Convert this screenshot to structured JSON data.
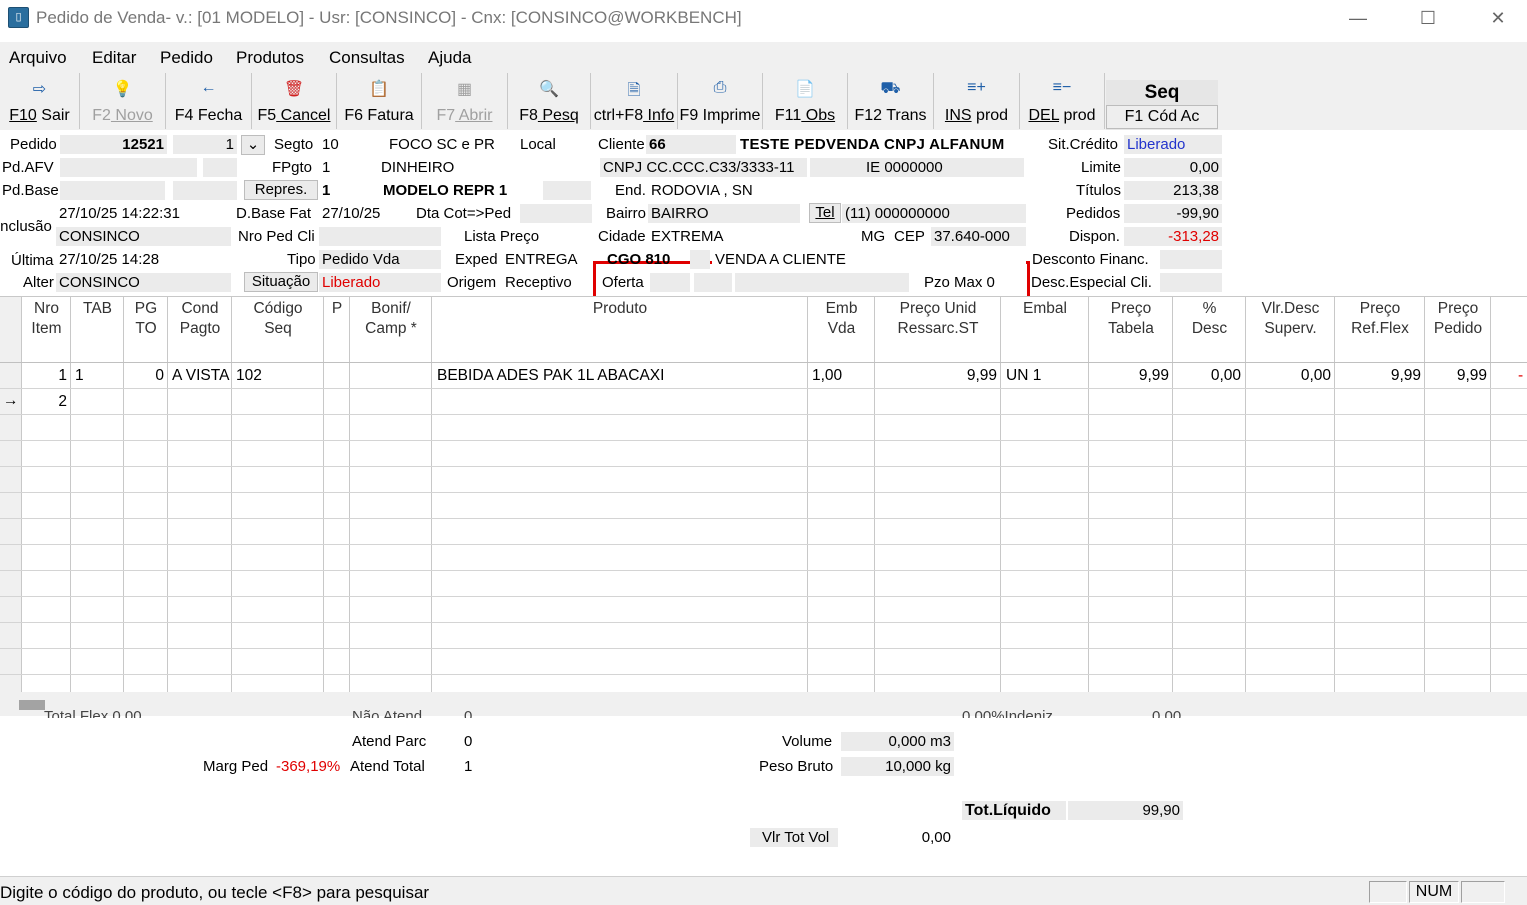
{
  "window": {
    "title": "Pedido de Venda- v.:  [01 MODELO] - Usr: [CONSINCO] - Cnx: [CONSINCO@WORKBENCH]",
    "minimize": "—",
    "maximize": "☐",
    "close": "✕"
  },
  "menu": [
    "Arquivo",
    "Editar",
    "Pedido",
    "Produtos",
    "Consultas",
    "Ajuda"
  ],
  "toolbar": [
    {
      "key": "F10",
      "rest": " Sair",
      "icon": "exit-icon",
      "glyph": "⇨",
      "enabled": true
    },
    {
      "key": "F2",
      "rest": " Novo",
      "icon": "lightbulb-icon",
      "glyph": "💡",
      "enabled": false
    },
    {
      "key": "F4",
      "rest": " Fecha",
      "icon": "arrow-left-icon",
      "glyph": "←",
      "enabled": true
    },
    {
      "key": "F5",
      "rest": " Cancel",
      "icon": "trash-icon",
      "glyph": "🗑",
      "enabled": true
    },
    {
      "key": "F6",
      "rest": " Fatura",
      "icon": "clipboard-icon",
      "glyph": "📋",
      "enabled": true
    },
    {
      "key": "F7",
      "rest": " Abrir",
      "icon": "table-icon",
      "glyph": "▦",
      "enabled": false
    },
    {
      "key": "F8",
      "rest": " Pesq",
      "icon": "search-icon",
      "glyph": "🔍",
      "enabled": true
    },
    {
      "key": "ctrl+F8",
      "rest": " Info",
      "icon": "document-icon",
      "glyph": "🗎",
      "enabled": true
    },
    {
      "key": "F9",
      "rest": " Imprime",
      "icon": "printer-icon",
      "glyph": "⎙",
      "enabled": true
    },
    {
      "key": "F11",
      "rest": " Obs",
      "icon": "notes-icon",
      "glyph": "📄",
      "enabled": true
    },
    {
      "key": "F12",
      "rest": " Trans",
      "icon": "truck-icon",
      "glyph": "⛟",
      "enabled": true
    },
    {
      "key": "INS",
      "rest": " prod",
      "icon": "add-product-icon",
      "glyph": "≡+",
      "enabled": true
    },
    {
      "key": "DEL",
      "rest": " prod",
      "icon": "remove-product-icon",
      "glyph": "≡−",
      "enabled": true
    }
  ],
  "seq": {
    "title": "Seq",
    "button": "F1 Cód Ac"
  },
  "form": {
    "pedido_label": "Pedido",
    "pedido": "12521",
    "pedido_seq": "1",
    "dropdown": "⌄",
    "pdafv_label": "Pd.AFV",
    "pdbase_label": "Pd.Base",
    "inclusao_label": "Inclusão",
    "inclusao_date": "27/10/25 14:22:31",
    "inclusao_user": "CONSINCO",
    "ultima_label": "Última",
    "ultima_date": "27/10/25 14:28",
    "alter_label": "Alter",
    "alter_user": "CONSINCO",
    "segto_label": "Segto",
    "segto": "10",
    "segto_desc": "FOCO SC e PR",
    "local_label": "Local",
    "fpgto_label": "FPgto",
    "fpgto": "1",
    "fpgto_desc": "DINHEIRO",
    "repres_button": "Repres.",
    "repres": "1",
    "repres_desc": "MODELO REPR 1",
    "dbasefat_label": "D.Base Fat",
    "dbasefat": "27/10/25",
    "dtacot_label": "Dta Cot=>Ped",
    "nroped_label": "Nro Ped Cli",
    "listapreco_label": "Lista Preço",
    "tipo_label": "Tipo",
    "tipo": "Pedido Vda",
    "exped_label": "Exped",
    "exped": "ENTREGA",
    "situacao_button": "Situação",
    "situacao": "Liberado",
    "origem_label": "Origem",
    "origem": "Receptivo",
    "cliente_label": "Cliente",
    "cliente": "66",
    "cliente_nome": "TESTE PEDVENDA CNPJ ALFANUM",
    "cnpj": "CNPJ CC.CCC.C33/3333-11",
    "ie": "IE 0000000",
    "end_label": "End.",
    "end": "RODOVIA , SN",
    "bairro_label": "Bairro",
    "bairro": "BAIRRO",
    "tel_button": "Tel",
    "tel": "(11) 000000000",
    "cidade_label": "Cidade",
    "cidade": "EXTREMA",
    "uf": "MG",
    "cep_label": "CEP",
    "cep": "37.640-000",
    "cgo_label": "CGO",
    "cgo": "810",
    "cgo_desc": "VENDA A CLIENTE",
    "oferta_label": "Oferta",
    "pzomax": "Pzo Max 0",
    "sitcredito_label": "Sit.Crédito",
    "sitcredito": "Liberado",
    "limite_label": "Limite",
    "limite": "0,00",
    "titulos_label": "Títulos",
    "titulos": "213,38",
    "pedidos_label": "Pedidos",
    "pedidos": "-99,90",
    "dispon_label": "Dispon.",
    "dispon": "-313,28",
    "descfin_label": "Desconto Financ.",
    "descesp_label": "Desc.Especial Cli."
  },
  "grid": {
    "headers": [
      "Nro\nItem",
      "TAB",
      "PG\nTO",
      "Cond\nPagto",
      "Código\nSeq",
      "P",
      "Bonif/\nCamp *",
      "Produto",
      "Emb\nVda",
      "Preço Unid\nRessarc.ST",
      "Embal",
      "Preço\nTabela",
      "%\nDesc",
      "Vlr.Desc\nSuperv.",
      "Preço\nRef.Flex",
      "Preço\nPedido"
    ],
    "row1": {
      "nro": "1",
      "tab": "1",
      "pgto": "0",
      "cond": "A VISTA",
      "codigo": "102",
      "produto": "BEBIDA ADES PAK 1L ABACAXI",
      "emb": "1,00",
      "preco_unid": "9,99",
      "embal": "UN 1",
      "preco_tabela": "9,99",
      "desc": "0,00",
      "vlr_desc": "0,00",
      "preco_ref": "9,99",
      "preco_pedido": "9,99",
      "extra": "-"
    },
    "row2": {
      "nro": "2",
      "marker": "→"
    }
  },
  "footer": {
    "totalflex_partial": "Total Flex      0,00",
    "naoatend_partial": "Não Atend",
    "naoatend_val": "0",
    "indeniz_partial": "0,00%Indeniz.",
    "indeniz_val": "0,00",
    "atendparc_label": "Atend Parc",
    "atendparc": "0",
    "margped_label": "Marg Ped",
    "margped": "-369,19%",
    "atendtotal_label": "Atend Total",
    "atendtotal": "1",
    "volume_label": "Volume",
    "volume": "0,000 m3",
    "pesobruto_label": "Peso Bruto",
    "pesobruto": "10,000 kg",
    "totliq_label": "Tot.Líquido",
    "totliq": "99,90",
    "vlrtotvol_label": "Vlr Tot Vol",
    "vlrtotvol": "0,00"
  },
  "status": {
    "message": "Digite o código do produto, ou tecle <F8> para pesquisar",
    "num": "NUM"
  }
}
